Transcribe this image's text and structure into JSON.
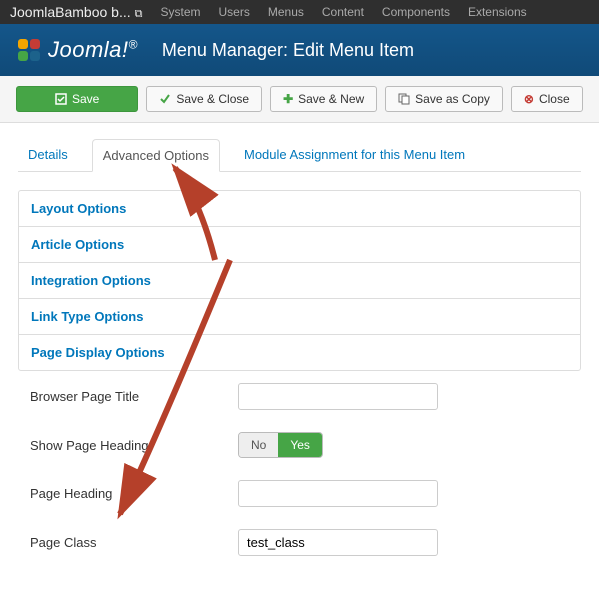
{
  "topbar": {
    "site": "JoomlaBamboo b...",
    "menus": [
      "System",
      "Users",
      "Menus",
      "Content",
      "Components",
      "Extensions"
    ]
  },
  "header": {
    "logo": "Joomla!",
    "title": "Menu Manager: Edit Menu Item"
  },
  "toolbar": {
    "save": "Save",
    "save_close": "Save & Close",
    "save_new": "Save & New",
    "save_copy": "Save as Copy",
    "close": "Close"
  },
  "tabs": {
    "details": "Details",
    "advanced": "Advanced Options",
    "module": "Module Assignment for this Menu Item"
  },
  "accordion": {
    "layout": "Layout Options",
    "article": "Article Options",
    "integration": "Integration Options",
    "linktype": "Link Type Options",
    "pagedisplay": "Page Display Options"
  },
  "form": {
    "browser_page_title_label": "Browser Page Title",
    "browser_page_title_value": "",
    "show_page_heading_label": "Show Page Heading",
    "toggle_no": "No",
    "toggle_yes": "Yes",
    "page_heading_label": "Page Heading",
    "page_heading_value": "",
    "page_class_label": "Page Class",
    "page_class_value": "test_class"
  }
}
